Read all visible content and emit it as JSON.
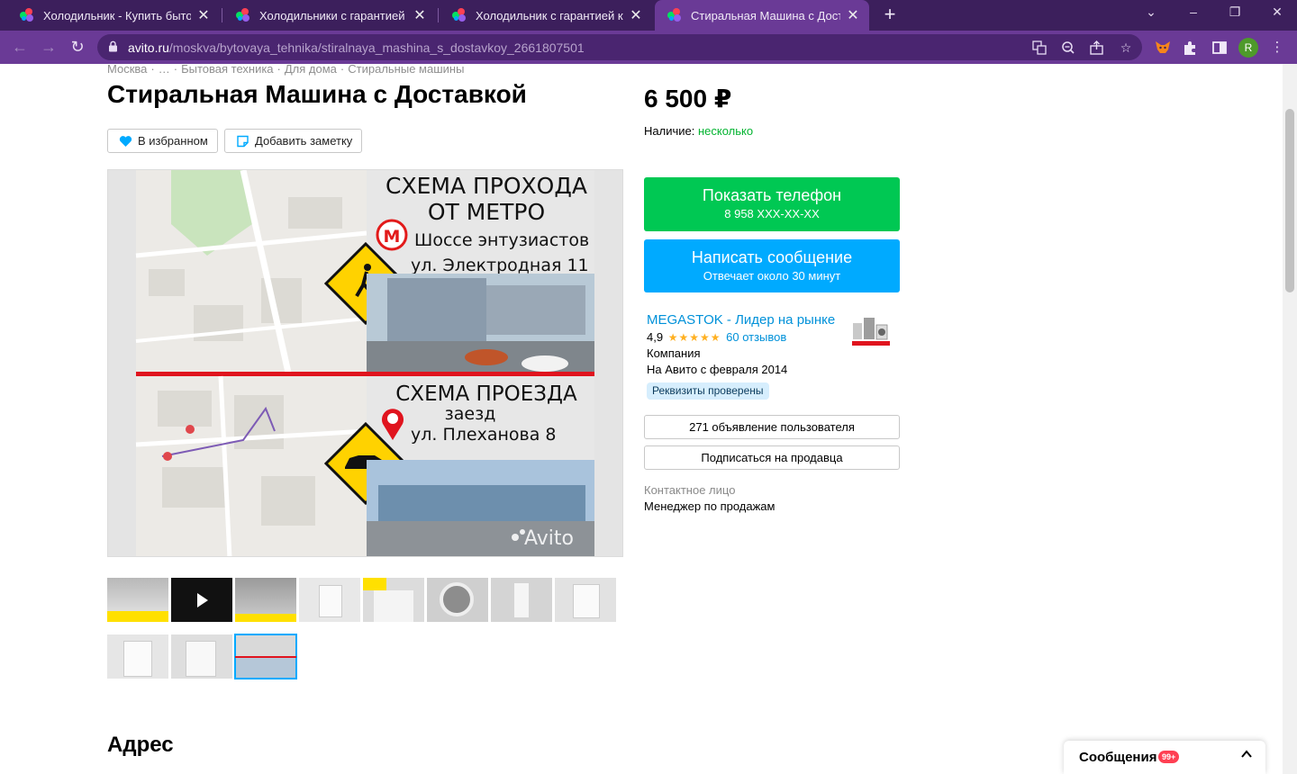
{
  "browser": {
    "tabs": [
      {
        "title": "Холодильник - Купить бытовую",
        "close": "✕"
      },
      {
        "title": "Холодильники с гарантией и бы",
        "close": "✕"
      },
      {
        "title": "Холодильник с гарантией купит",
        "close": "✕"
      },
      {
        "title": "Стиральная Машина с Доставко",
        "close": "✕"
      }
    ],
    "new_tab": "+",
    "url_host": "avito.ru",
    "url_path": "/moskva/bytovaya_tehnika/stiralnaya_mashina_s_dostavkoy_2661807501",
    "profile_initial": "R"
  },
  "breadcrumbs": [
    "Москва",
    "…",
    "Бытовая техника",
    "Для дома",
    "Стиральные машины"
  ],
  "breadcrumb_sep": "·",
  "title": "Стиральная Машина с Доставкой",
  "actions": {
    "favorite": "В избранном",
    "note": "Добавить заметку"
  },
  "gallery": {
    "top_heading_1": "СХЕМА ПРОХОДА",
    "top_heading_2": "ОТ МЕТРО",
    "top_line_1": "Шоссе энтузиастов",
    "top_line_2": "ул. Электродная 11",
    "bottom_heading": "СХЕМА ПРОЕЗДА",
    "bottom_line_1": "заезд",
    "bottom_line_2": "ул. Плеханова 8",
    "watermark": "Avito",
    "thumbnail_count": 11,
    "selected_thumbnail": 11
  },
  "address_heading": "Адрес",
  "price": "6 500 ₽",
  "availability": {
    "label": "Наличие:",
    "value": "несколько"
  },
  "phone_button": {
    "title": "Показать телефон",
    "sub": "8 958 XXX-XX-XX"
  },
  "message_button": {
    "title": "Написать сообщение",
    "sub": "Отвечает около 30 минут"
  },
  "seller": {
    "name": "MEGASTOK - Лидер на рынке",
    "rating": "4,9",
    "stars": "★★★★★",
    "reviews": "60 отзывов",
    "type": "Компания",
    "since": "На Авито с февраля 2014",
    "verified": "Реквизиты проверены"
  },
  "user_ads_button": "271 объявление пользователя",
  "subscribe_button": "Подписаться на продавца",
  "contact": {
    "label": "Контактное лицо",
    "value": "Менеджер по продажам"
  },
  "messages_panel": {
    "label": "Сообщения",
    "badge": "99+"
  },
  "colors": {
    "green": "#00c853",
    "blue": "#00aaff",
    "purple": "#6a3a96"
  }
}
